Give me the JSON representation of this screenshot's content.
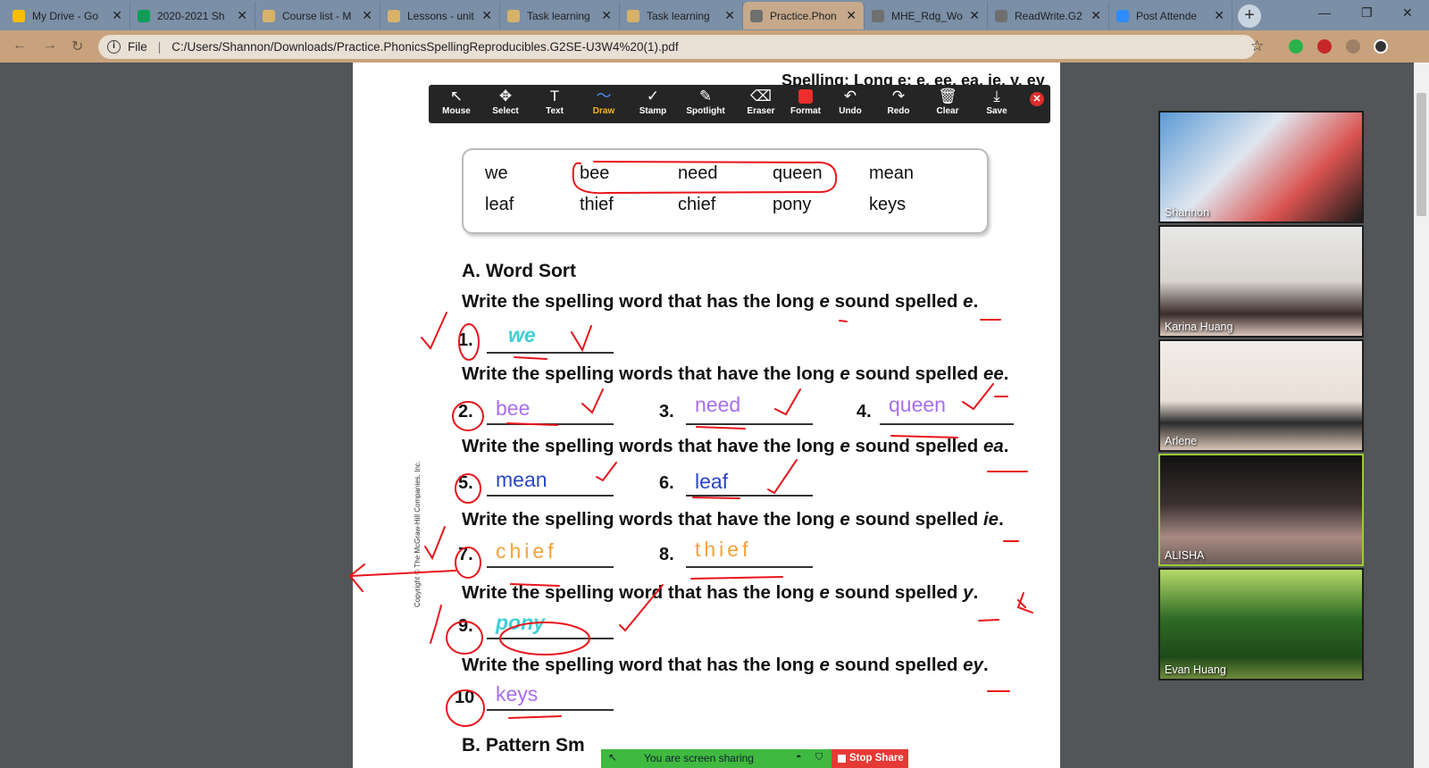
{
  "tabs": [
    {
      "title": "My Drive - Go",
      "color": "#fbbc04"
    },
    {
      "title": "2020-2021 Sh",
      "color": "#0f9d58"
    },
    {
      "title": "Course list - M",
      "color": "#d7b36a"
    },
    {
      "title": "Lessons - unit",
      "color": "#d7b36a"
    },
    {
      "title": "Task learning",
      "color": "#d7b36a"
    },
    {
      "title": "Task learning",
      "color": "#d7b36a"
    },
    {
      "title": "Practice.Phon",
      "color": "#6f6f6f"
    },
    {
      "title": "MHE_Rdg_Wo",
      "color": "#6f6f6f"
    },
    {
      "title": "ReadWrite.G2",
      "color": "#6f6f6f"
    },
    {
      "title": "Post Attende",
      "color": "#2d8cff"
    }
  ],
  "address": {
    "scheme": "File",
    "url": "C:/Users/Shannon/Downloads/Practice.PhonicsSpellingReproducibles.G2SE-U3W4%20(1).pdf"
  },
  "doc": {
    "top_partial": "Spelling: Long e: e, ee, ea, ie, y, ey",
    "word_bank": [
      "we",
      "bee",
      "need",
      "queen",
      "mean",
      "leaf",
      "thief",
      "chief",
      "pony",
      "keys"
    ],
    "section_a": "A. Word Sort",
    "section_b": "B. Pattern Sm",
    "copyright": "Copyright © The McGraw-Hill Companies, Inc.",
    "inst1": {
      "pre": "Write the spelling word that has the long ",
      "e": "e",
      "mid": " sound spelled ",
      "sp": "e",
      "end": "."
    },
    "inst2": {
      "pre": "Write the spelling words that have the long ",
      "e": "e",
      "mid": " sound spelled ",
      "sp": "ee",
      "end": "."
    },
    "inst3": {
      "pre": "Write the spelling words that have the long ",
      "e": "e",
      "mid": " sound spelled ",
      "sp": "ea",
      "end": "."
    },
    "inst4": {
      "pre": "Write the spelling words that have the long ",
      "e": "e",
      "mid": " sound spelled ",
      "sp": "ie",
      "end": "."
    },
    "inst5": {
      "pre": "Write the spelling word that has the long ",
      "e": "e",
      "mid": " sound spelled ",
      "sp": "y",
      "end": "."
    },
    "inst6": {
      "pre": "Write the spelling word that has the long ",
      "e": "e",
      "mid": " sound spelled ",
      "sp": "ey",
      "end": "."
    },
    "nums": [
      "1.",
      "2.",
      "3.",
      "4.",
      "5.",
      "6.",
      "7.",
      "8.",
      "9.",
      "10"
    ],
    "answers": [
      "we",
      "bee",
      "need",
      "queen",
      "mean",
      "leaf",
      "chief",
      "thief",
      "pony",
      "keys"
    ]
  },
  "zoom_toolbar": {
    "tools": [
      "Mouse",
      "Select",
      "Text",
      "Draw",
      "Stamp",
      "Spotlight",
      "Eraser",
      "Format",
      "Undo",
      "Redo",
      "Clear",
      "Save"
    ],
    "active": "Draw"
  },
  "share_bar": {
    "status": "You are screen sharing",
    "stop": "Stop Share"
  },
  "participants": [
    "Shannon",
    "Karina Huang",
    "Arlene",
    "ALISHA",
    "Evan Huang"
  ]
}
